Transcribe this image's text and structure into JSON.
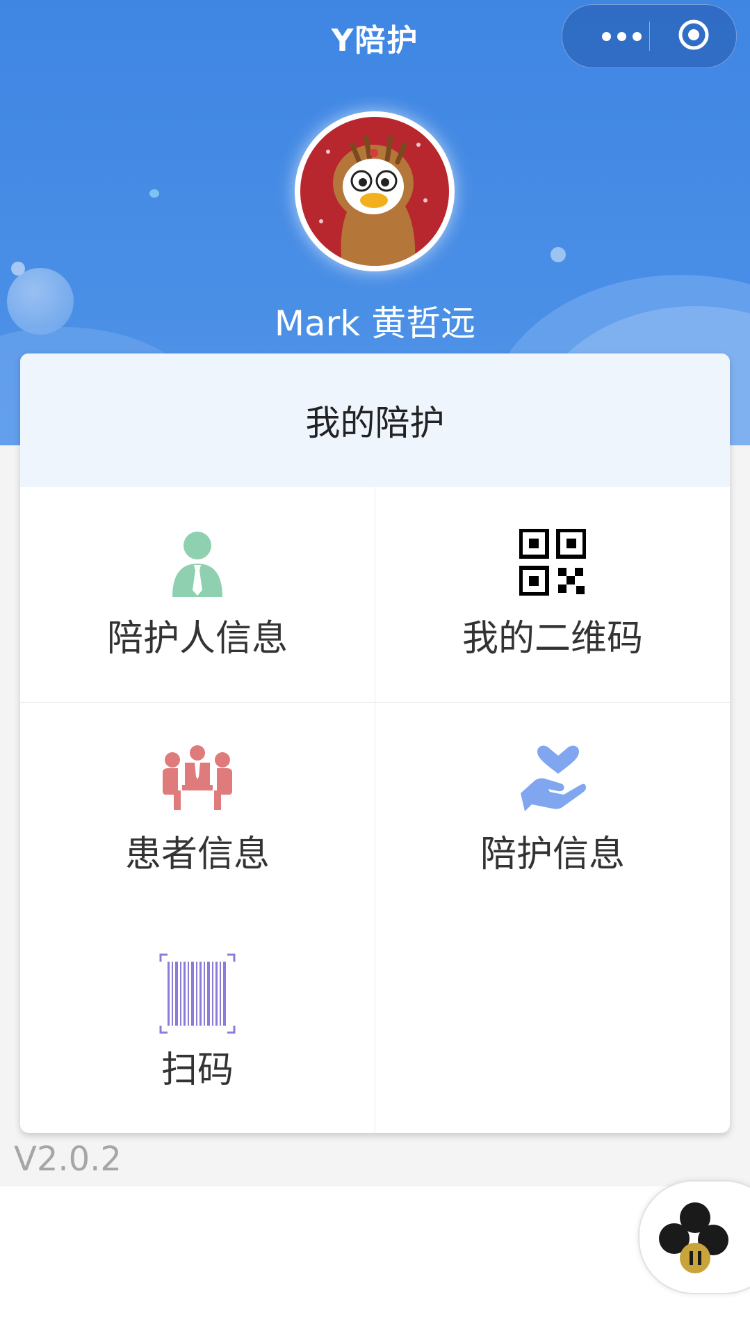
{
  "header": {
    "app_title": "Y陪护"
  },
  "capsule": {
    "more_icon": "more-dots-icon",
    "close_icon": "target-circle-icon"
  },
  "profile": {
    "name": "Mark 黄哲远",
    "avatar": "cartoon-duck-reindeer-avatar"
  },
  "card": {
    "title": "我的陪护",
    "items": [
      {
        "label": "陪护人信息",
        "icon": "caregiver-person-icon",
        "color": "#8fd0b0"
      },
      {
        "label": "我的二维码",
        "icon": "qr-code-icon",
        "color": "#000000"
      },
      {
        "label": "患者信息",
        "icon": "patients-group-icon",
        "color": "#e07b7b"
      },
      {
        "label": "陪护信息",
        "icon": "heart-hand-icon",
        "color": "#7fa6ee"
      },
      {
        "label": "扫码",
        "icon": "barcode-scan-icon",
        "color": "#8a7cd8"
      }
    ]
  },
  "footer": {
    "version": "V2.0.2",
    "float_icon": "floating-app-icon"
  },
  "colors": {
    "header_blue": "#3f86e3",
    "card_header_bg": "#eef5fd",
    "version_gray": "#a6a6a6"
  }
}
